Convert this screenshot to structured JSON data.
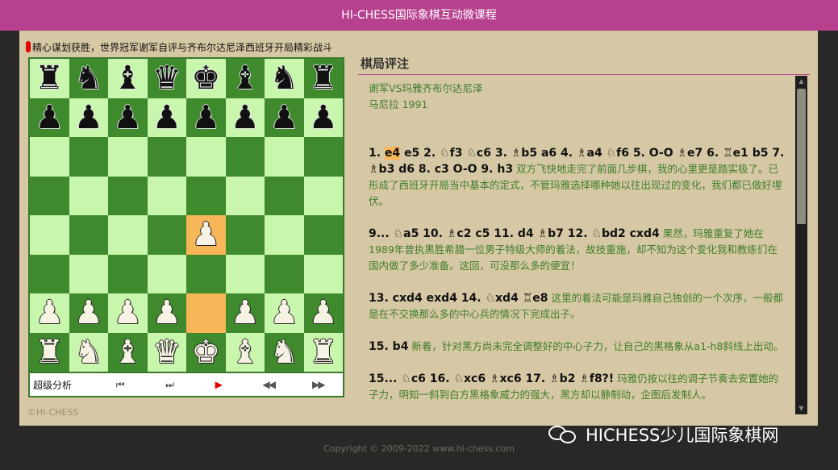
{
  "header": {
    "title": "HI-CHESS国际象棋互动微课程"
  },
  "subtitle": "精心谋划获胜，世界冠军谢军自评与齐布尔达尼泽西班牙开局精彩战斗",
  "board": {
    "ranks": [
      [
        "b:♜",
        "b:♞",
        "b:♝",
        "b:♛",
        "b:♚",
        "b:♝",
        "b:♞",
        "b:♜"
      ],
      [
        "b:♟",
        "b:♟",
        "b:♟",
        "b:♟",
        "b:♟",
        "b:♟",
        "b:♟",
        "b:♟"
      ],
      [
        "",
        "",
        "",
        "",
        "",
        "",
        "",
        ""
      ],
      [
        "",
        "",
        "",
        "",
        "",
        "",
        "",
        ""
      ],
      [
        "",
        "",
        "",
        "",
        "w:♟",
        "",
        "",
        ""
      ],
      [
        "",
        "",
        "",
        "",
        "",
        "",
        "",
        ""
      ],
      [
        "w:♟",
        "w:♟",
        "w:♟",
        "w:♟",
        "",
        "w:♟",
        "w:♟",
        "w:♟"
      ],
      [
        "w:♜",
        "w:♞",
        "w:♝",
        "w:♛",
        "w:♚",
        "w:♝",
        "w:♞",
        "w:♜"
      ]
    ],
    "highlight": [
      "e4",
      "e2"
    ]
  },
  "controls": {
    "label": "超级分析",
    "first": "⏮",
    "prev_fast": "⏭",
    "play": "▶",
    "back": "◀◀",
    "forward": "▶▶"
  },
  "copyright_small": "©HI-CHESS",
  "review": {
    "title": "棋局评注",
    "meta1": "谢军VS玛雅齐布尔达尼泽",
    "meta2": "马尼拉 1991",
    "p1": {
      "pre": "1. ",
      "hl": "e4",
      "moves": " e5 2. ♘f3 ♘c6 3. ♗b5 a6 4. ♗a4 ♘f6 5. O-O ♗e7 6. ♖e1 b5 7. ♗b3 d6 8. c3 O-O 9. h3",
      "comment": " 双方飞快地走完了前面几步棋，我的心里更是踏实极了。已形成了西班牙开局当中基本的定式，不管玛雅选择哪种她以往出现过的变化，我们都已做好埋伏。"
    },
    "p2": {
      "moves": "9... ♘a5 10. ♗c2 c5 11. d4 ♗b7 12. ♘bd2 cxd4",
      "comment": " 果然，玛雅重复了她在1989年曾执黑胜希腊一位男子特级大师的着法，故技重施，却不知为这个变化我和教练们在国内做了多少准备。这回，可没那么多的便宜！"
    },
    "p3": {
      "moves": "13. cxd4 exd4 14. ♘xd4 ♖e8",
      "comment": " 这里的着法可能是玛雅自己独创的一个次序，一般都是在不交换那么多的中心兵的情况下完成出子。"
    },
    "p4": {
      "moves": "15. b4",
      "comment": " 新着，针对黑方尚未完全调整好的中心子力，让自己的黑格象从a1-h8斜线上出动。"
    },
    "p5": {
      "moves": "15... ♘c6 16. ♘xc6 ♗xc6 17. ♗b2 ♗f8?!",
      "comment": " 玛雅仍按以往的调子节奏去安置她的子力，明知一斜到白方黑格象威力的强大，黑方却以静制动，企图后发制人。"
    }
  },
  "footer": "Copyright © 2009-2022 www.hi-chess.com",
  "watermark": "HICHESS少儿国际象棋网"
}
